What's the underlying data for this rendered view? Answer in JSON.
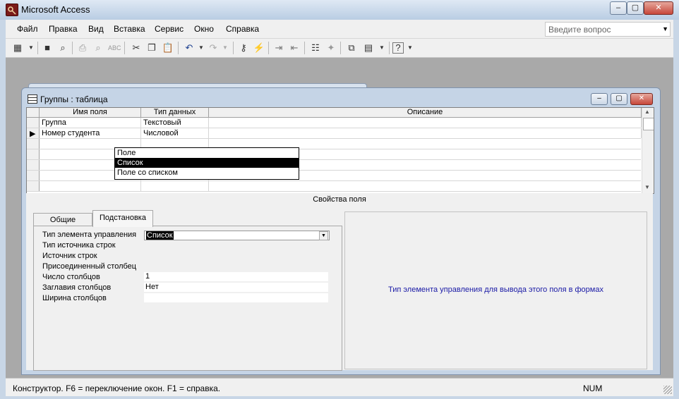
{
  "app": {
    "title": "Microsoft Access",
    "logo_icon": "key-icon"
  },
  "window_controls": {
    "minimize": "–",
    "restore": "▢",
    "close": "✕"
  },
  "menu": {
    "items": [
      {
        "label": "Файл",
        "access_key": "Ф"
      },
      {
        "label": "Правка",
        "access_key": "П"
      },
      {
        "label": "Вид",
        "access_key": "В"
      },
      {
        "label": "Вставка",
        "access_key": "с"
      },
      {
        "label": "Сервис",
        "access_key": "С"
      },
      {
        "label": "Окно",
        "access_key": "О"
      },
      {
        "label": "Справка",
        "access_key": "С"
      }
    ],
    "help_placeholder": "Введите вопрос"
  },
  "toolbar": {
    "icons": [
      "view-icon",
      "save-icon",
      "search-icon",
      "print-icon",
      "print-preview-icon",
      "spelling-icon",
      "cut-icon",
      "copy-icon",
      "paste-icon",
      "undo-icon",
      "redo-icon",
      "primary-key-icon",
      "indexes-icon",
      "insert-rows-icon",
      "delete-rows-icon",
      "properties-icon",
      "build-icon",
      "database-window-icon",
      "new-object-icon",
      "help-icon"
    ]
  },
  "child_window": {
    "title": "Группы : таблица",
    "grid": {
      "headers": [
        "Имя поля",
        "Тип данных",
        "Описание"
      ],
      "rows": [
        {
          "name": "Группа",
          "type": "Текстовый",
          "description": ""
        },
        {
          "name": "Номер студента",
          "type": "Числовой",
          "description": ""
        }
      ],
      "current_row": 1
    },
    "field_properties": {
      "header": "Свойства поля",
      "tabs": [
        "Общие",
        "Подстановка"
      ],
      "active_tab": "Подстановка",
      "properties": [
        {
          "label": "Тип элемента управления",
          "value": "Список"
        },
        {
          "label": "Тип источника строк",
          "value": ""
        },
        {
          "label": "Источник строк",
          "value": ""
        },
        {
          "label": "Присоединенный столбец",
          "value": ""
        },
        {
          "label": "Число столбцов",
          "value": "1"
        },
        {
          "label": "Заглавия столбцов",
          "value": "Нет"
        },
        {
          "label": "Ширина столбцов",
          "value": ""
        }
      ],
      "dropdown": {
        "options": [
          "Поле",
          "Список",
          "Поле со списком"
        ],
        "selected": "Список"
      },
      "description": "Тип элемента управления для вывода этого поля в формах"
    }
  },
  "status": {
    "text": "Конструктор.  F6 = переключение окон.  F1 = справка.",
    "num": "NUM"
  }
}
